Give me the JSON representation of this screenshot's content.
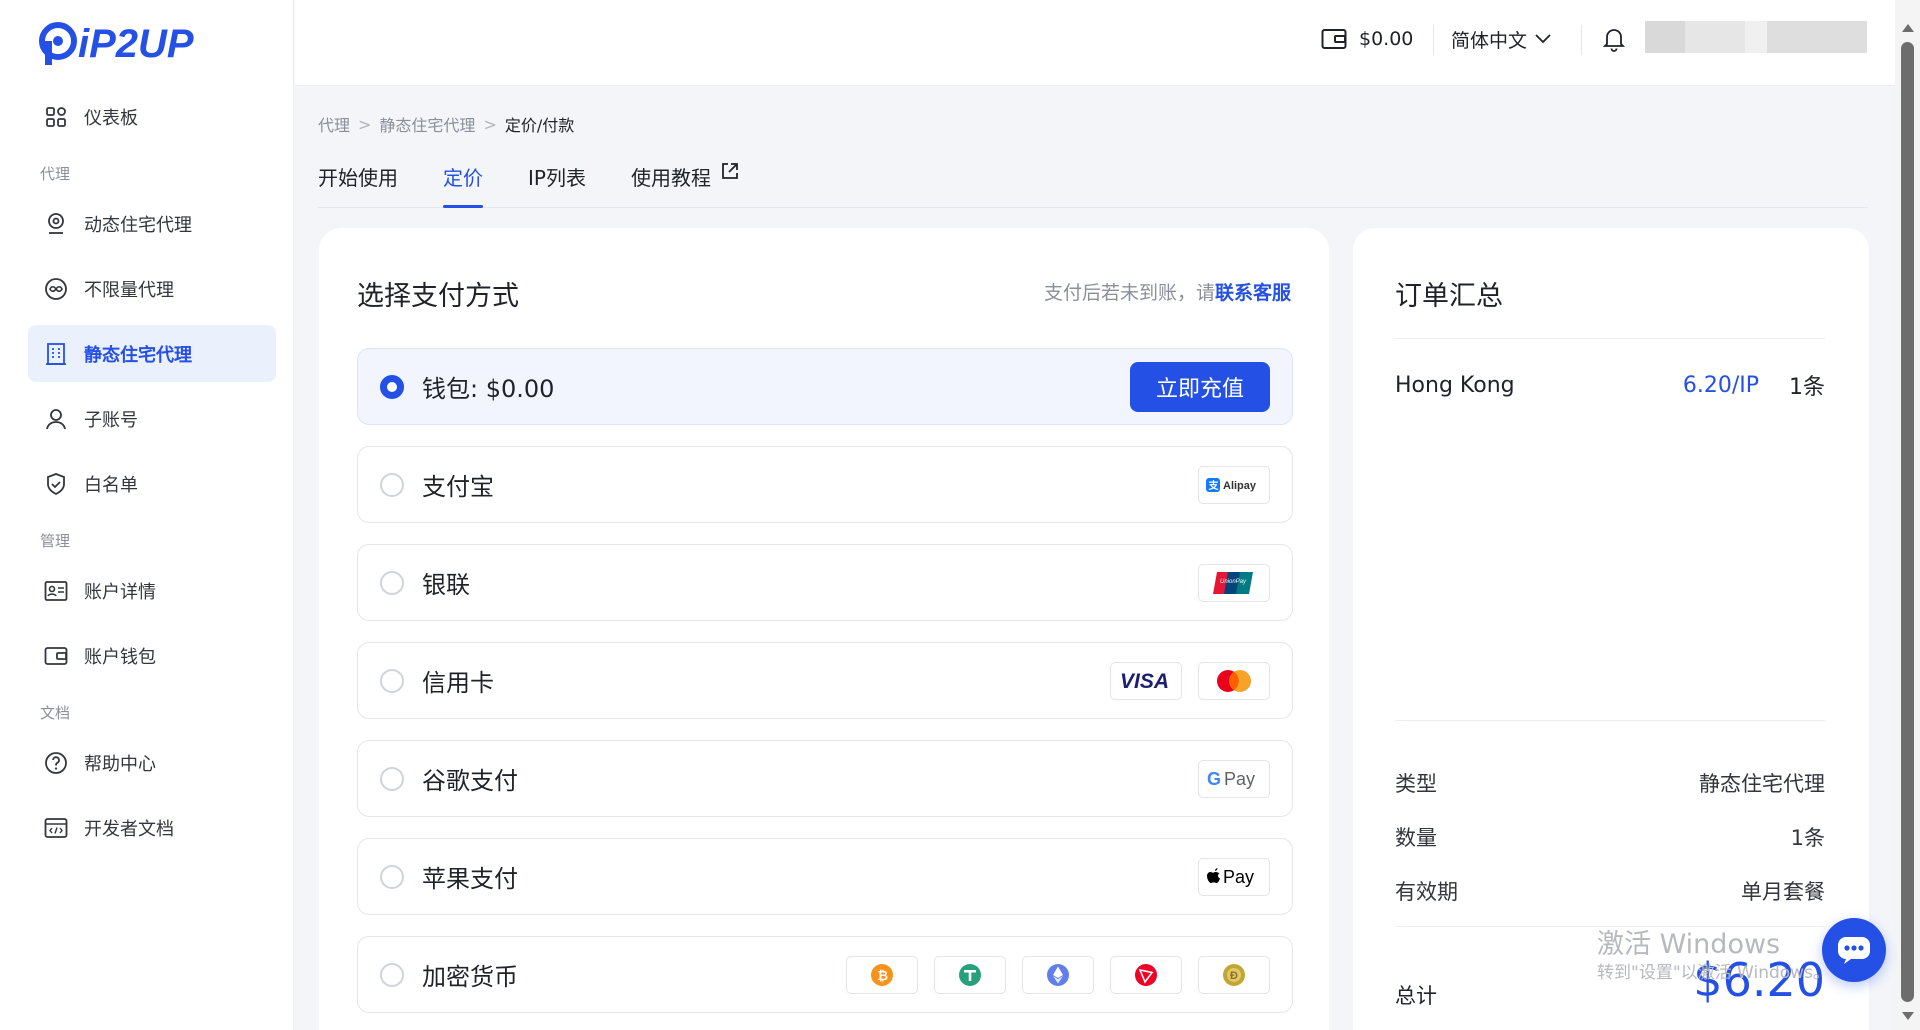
{
  "brand": {
    "logo_text": "iP2UP",
    "accent": "#2550e6"
  },
  "sidebar": {
    "items": [
      {
        "type": "item",
        "label": "仪表板",
        "icon": "dashboard-icon"
      },
      {
        "type": "section",
        "label": "代理"
      },
      {
        "type": "item",
        "label": "动态住宅代理",
        "icon": "location-pin-icon"
      },
      {
        "type": "item",
        "label": "不限量代理",
        "icon": "infinity-icon"
      },
      {
        "type": "item",
        "label": "静态住宅代理",
        "icon": "building-icon",
        "active": true
      },
      {
        "type": "item",
        "label": "子账号",
        "icon": "user-icon"
      },
      {
        "type": "item",
        "label": "白名单",
        "icon": "shield-icon"
      },
      {
        "type": "section",
        "label": "管理"
      },
      {
        "type": "item",
        "label": "账户详情",
        "icon": "id-card-icon"
      },
      {
        "type": "item",
        "label": "账户钱包",
        "icon": "wallet-icon"
      },
      {
        "type": "section",
        "label": "文档"
      },
      {
        "type": "item",
        "label": "帮助中心",
        "icon": "help-circle-icon"
      },
      {
        "type": "item",
        "label": "开发者文档",
        "icon": "code-doc-icon"
      }
    ]
  },
  "header": {
    "wallet_balance": "$0.00",
    "language": "简体中文"
  },
  "breadcrumb": [
    "代理",
    "静态住宅代理",
    "定价/付款"
  ],
  "tabs": [
    {
      "label": "开始使用"
    },
    {
      "label": "定价",
      "active": true
    },
    {
      "label": "IP列表"
    },
    {
      "label": "使用教程",
      "external": true
    }
  ],
  "payment": {
    "title": "选择支付方式",
    "note_prefix": "支付后若未到账，请",
    "note_link": "联系客服",
    "recharge_label": "立即充值",
    "options": [
      {
        "label": "钱包: $0.00",
        "selected": true,
        "badges": []
      },
      {
        "label": "支付宝",
        "badges": [
          "alipay"
        ]
      },
      {
        "label": "银联",
        "badges": [
          "unionpay"
        ]
      },
      {
        "label": "信用卡",
        "badges": [
          "visa",
          "mastercard"
        ]
      },
      {
        "label": "谷歌支付",
        "badges": [
          "gpay"
        ]
      },
      {
        "label": "苹果支付",
        "badges": [
          "applepay"
        ]
      },
      {
        "label": "加密货币",
        "badges": [
          "bitcoin",
          "tether",
          "ethereum",
          "tron",
          "dogecoin"
        ]
      }
    ],
    "badge_text": {
      "alipay": "Alipay",
      "visa": "VISA",
      "gpay": "Pay",
      "applepay": "Pay",
      "unionpay": "UnionPay"
    }
  },
  "order": {
    "title": "订单汇总",
    "item": {
      "name": "Hong Kong",
      "price": "6.20/IP",
      "qty": "1条"
    },
    "rows": [
      {
        "k": "类型",
        "v": "静态住宅代理"
      },
      {
        "k": "数量",
        "v": "1条"
      },
      {
        "k": "有效期",
        "v": "单月套餐"
      }
    ],
    "total_label": "总计",
    "total_value": "$6.20"
  },
  "watermark": {
    "line1": "激活 Windows",
    "line2": "转到\"设置\"以激活 Windows。"
  }
}
